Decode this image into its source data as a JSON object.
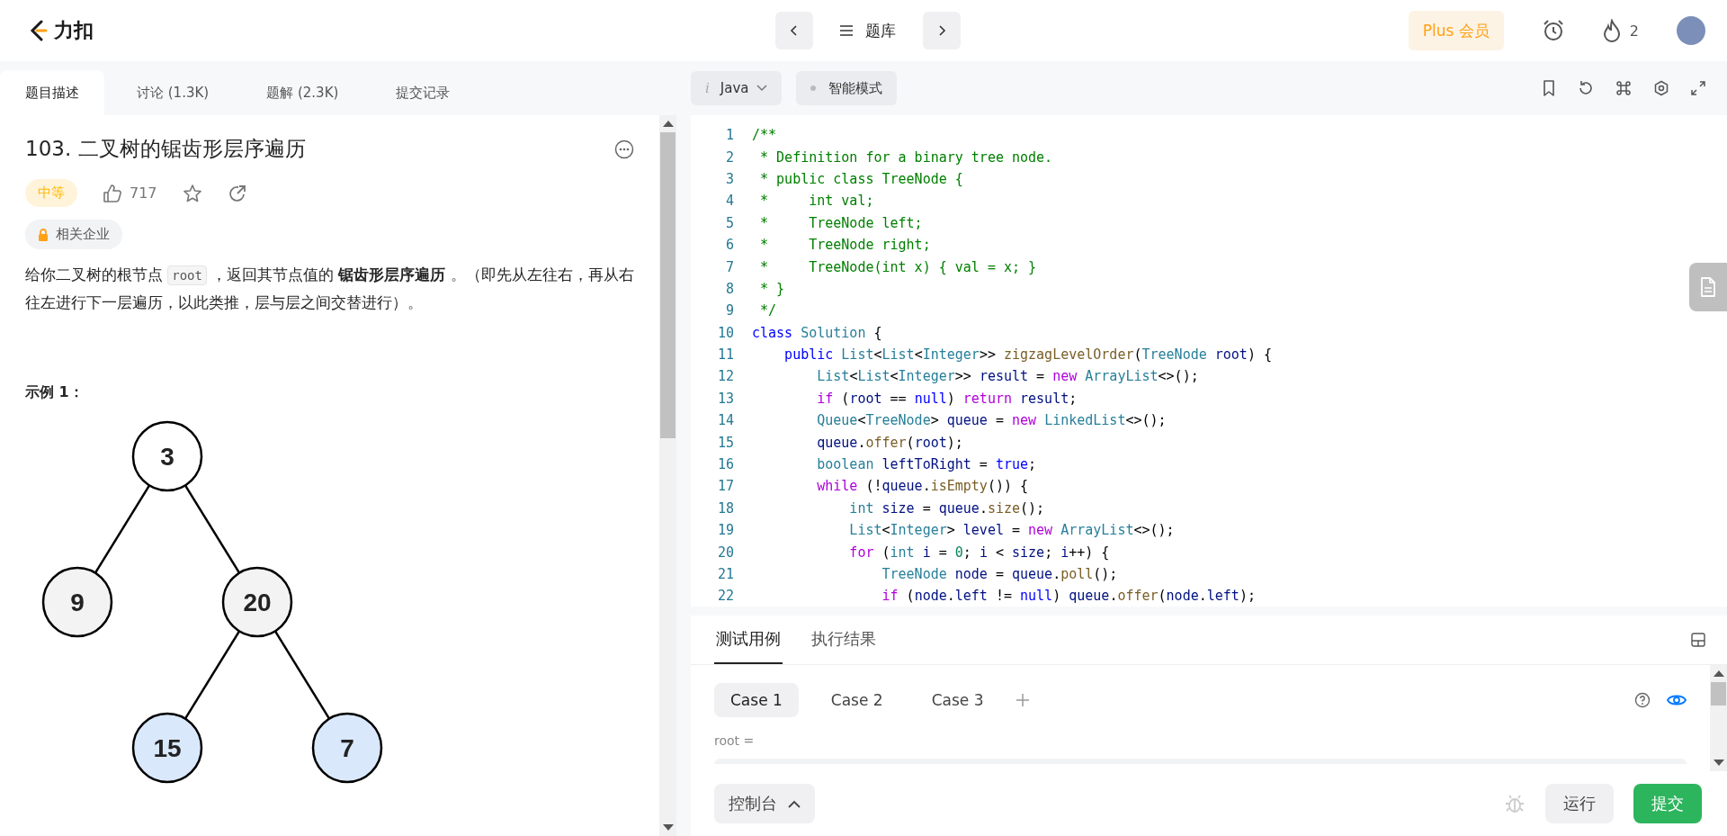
{
  "nav": {
    "logo_text": "力扣",
    "problem_list": "题库",
    "plus": "Plus 会员",
    "streak": "2"
  },
  "left_tabs": [
    {
      "label": "题目描述",
      "selected": true
    },
    {
      "label": "讨论 (1.3K)",
      "selected": false
    },
    {
      "label": "题解 (2.3K)",
      "selected": false
    },
    {
      "label": "提交记录",
      "selected": false
    }
  ],
  "problem": {
    "title": "103. 二叉树的锯齿形层序遍历",
    "difficulty": "中等",
    "likes": "717",
    "companies": "相关企业",
    "description": [
      {
        "kind": "text",
        "text": "给你二叉树的根节点 "
      },
      {
        "kind": "code",
        "text": "root"
      },
      {
        "kind": "text",
        "text": " ，返回其节点值的 **锯齿形层序遍历** 。（即先从左往右，再从右往左进行下一层遍历，以此类推，层与层之间交替进行）。"
      }
    ],
    "example_title": "示例 1：",
    "tree": {
      "value": "3",
      "color": "#ffffff",
      "children": [
        {
          "value": "9",
          "color": "#f3f3f3"
        },
        {
          "value": "20",
          "color": "#f3f3f3",
          "children": [
            {
              "value": "15",
              "color": "#dae8fc"
            },
            {
              "value": "7",
              "color": "#dae8fc"
            }
          ]
        }
      ]
    }
  },
  "editor": {
    "language_icon": "i",
    "language": "Java",
    "mode": "智能模式",
    "lines": [
      {
        "number": "1",
        "tokens": [
          {
            "kind": "comment",
            "text": "/**"
          }
        ]
      },
      {
        "number": "2",
        "tokens": [
          {
            "kind": "comment",
            "text": " * Definition for a binary tree node."
          }
        ]
      },
      {
        "number": "3",
        "tokens": [
          {
            "kind": "comment",
            "text": " * public class TreeNode {"
          }
        ]
      },
      {
        "number": "4",
        "tokens": [
          {
            "kind": "comment",
            "text": " *     int val;"
          }
        ]
      },
      {
        "number": "5",
        "tokens": [
          {
            "kind": "comment",
            "text": " *     TreeNode left;"
          }
        ]
      },
      {
        "number": "6",
        "tokens": [
          {
            "kind": "comment",
            "text": " *     TreeNode right;"
          }
        ]
      },
      {
        "number": "7",
        "tokens": [
          {
            "kind": "comment",
            "text": " *     TreeNode(int x) { val = x; }"
          }
        ]
      },
      {
        "number": "8",
        "tokens": [
          {
            "kind": "comment",
            "text": " * }"
          }
        ]
      },
      {
        "number": "9",
        "tokens": [
          {
            "kind": "comment",
            "text": " */"
          }
        ]
      },
      {
        "number": "10",
        "tokens": [
          {
            "kind": "keyword",
            "text": "class "
          },
          {
            "kind": "type",
            "text": "Solution"
          },
          {
            "kind": "plain",
            "text": " {"
          }
        ]
      },
      {
        "number": "11",
        "tokens": [
          {
            "kind": "keyword",
            "text": "    public "
          },
          {
            "kind": "type",
            "text": "List"
          },
          {
            "kind": "plain",
            "text": "<"
          },
          {
            "kind": "type",
            "text": "List"
          },
          {
            "kind": "plain",
            "text": "<"
          },
          {
            "kind": "type",
            "text": "Integer"
          },
          {
            "kind": "plain",
            "text": ">> "
          },
          {
            "kind": "function",
            "text": "zigzagLevelOrder"
          },
          {
            "kind": "plain",
            "text": "("
          },
          {
            "kind": "type",
            "text": "TreeNode "
          },
          {
            "kind": "variable",
            "text": "root"
          },
          {
            "kind": "plain",
            "text": ") {"
          }
        ]
      },
      {
        "number": "12",
        "tokens": [
          {
            "kind": "type",
            "text": "        List"
          },
          {
            "kind": "plain",
            "text": "<"
          },
          {
            "kind": "type",
            "text": "List"
          },
          {
            "kind": "plain",
            "text": "<"
          },
          {
            "kind": "type",
            "text": "Integer"
          },
          {
            "kind": "plain",
            "text": ">> "
          },
          {
            "kind": "variable",
            "text": "result"
          },
          {
            "kind": "plain",
            "text": " = "
          },
          {
            "kind": "control",
            "text": "new "
          },
          {
            "kind": "type",
            "text": "ArrayList"
          },
          {
            "kind": "plain",
            "text": "<>();"
          }
        ]
      },
      {
        "number": "13",
        "tokens": [
          {
            "kind": "control",
            "text": "        if"
          },
          {
            "kind": "plain",
            "text": " ("
          },
          {
            "kind": "variable",
            "text": "root"
          },
          {
            "kind": "plain",
            "text": " == "
          },
          {
            "kind": "keyword",
            "text": "null"
          },
          {
            "kind": "plain",
            "text": ") "
          },
          {
            "kind": "control",
            "text": "return "
          },
          {
            "kind": "variable",
            "text": "result"
          },
          {
            "kind": "plain",
            "text": ";"
          }
        ]
      },
      {
        "number": "14",
        "tokens": [
          {
            "kind": "type",
            "text": "        Queue"
          },
          {
            "kind": "plain",
            "text": "<"
          },
          {
            "kind": "type",
            "text": "TreeNode"
          },
          {
            "kind": "plain",
            "text": "> "
          },
          {
            "kind": "variable",
            "text": "queue"
          },
          {
            "kind": "plain",
            "text": " = "
          },
          {
            "kind": "control",
            "text": "new "
          },
          {
            "kind": "type",
            "text": "LinkedList"
          },
          {
            "kind": "plain",
            "text": "<>();"
          }
        ]
      },
      {
        "number": "15",
        "tokens": [
          {
            "kind": "variable",
            "text": "        queue"
          },
          {
            "kind": "plain",
            "text": "."
          },
          {
            "kind": "function",
            "text": "offer"
          },
          {
            "kind": "plain",
            "text": "("
          },
          {
            "kind": "variable",
            "text": "root"
          },
          {
            "kind": "plain",
            "text": ");"
          }
        ]
      },
      {
        "number": "16",
        "tokens": [
          {
            "kind": "type",
            "text": "        boolean "
          },
          {
            "kind": "variable",
            "text": "leftToRight"
          },
          {
            "kind": "plain",
            "text": " = "
          },
          {
            "kind": "keyword",
            "text": "true"
          },
          {
            "kind": "plain",
            "text": ";"
          }
        ]
      },
      {
        "number": "17",
        "tokens": [
          {
            "kind": "control",
            "text": "        while"
          },
          {
            "kind": "plain",
            "text": " (!"
          },
          {
            "kind": "variable",
            "text": "queue"
          },
          {
            "kind": "plain",
            "text": "."
          },
          {
            "kind": "function",
            "text": "isEmpty"
          },
          {
            "kind": "plain",
            "text": "()) {"
          }
        ]
      },
      {
        "number": "18",
        "tokens": [
          {
            "kind": "type",
            "text": "            int "
          },
          {
            "kind": "variable",
            "text": "size"
          },
          {
            "kind": "plain",
            "text": " = "
          },
          {
            "kind": "variable",
            "text": "queue"
          },
          {
            "kind": "plain",
            "text": "."
          },
          {
            "kind": "function",
            "text": "size"
          },
          {
            "kind": "plain",
            "text": "();"
          }
        ]
      },
      {
        "number": "19",
        "tokens": [
          {
            "kind": "type",
            "text": "            List"
          },
          {
            "kind": "plain",
            "text": "<"
          },
          {
            "kind": "type",
            "text": "Integer"
          },
          {
            "kind": "plain",
            "text": "> "
          },
          {
            "kind": "variable",
            "text": "level"
          },
          {
            "kind": "plain",
            "text": " = "
          },
          {
            "kind": "control",
            "text": "new "
          },
          {
            "kind": "type",
            "text": "ArrayList"
          },
          {
            "kind": "plain",
            "text": "<>();"
          }
        ]
      },
      {
        "number": "20",
        "tokens": [
          {
            "kind": "control",
            "text": "            for"
          },
          {
            "kind": "plain",
            "text": " ("
          },
          {
            "kind": "type",
            "text": "int "
          },
          {
            "kind": "variable",
            "text": "i"
          },
          {
            "kind": "plain",
            "text": " = "
          },
          {
            "kind": "number",
            "text": "0"
          },
          {
            "kind": "plain",
            "text": "; "
          },
          {
            "kind": "variable",
            "text": "i"
          },
          {
            "kind": "plain",
            "text": " < "
          },
          {
            "kind": "variable",
            "text": "size"
          },
          {
            "kind": "plain",
            "text": "; "
          },
          {
            "kind": "variable",
            "text": "i"
          },
          {
            "kind": "plain",
            "text": "++) {"
          }
        ]
      },
      {
        "number": "21",
        "tokens": [
          {
            "kind": "type",
            "text": "                TreeNode "
          },
          {
            "kind": "variable",
            "text": "node"
          },
          {
            "kind": "plain",
            "text": " = "
          },
          {
            "kind": "variable",
            "text": "queue"
          },
          {
            "kind": "plain",
            "text": "."
          },
          {
            "kind": "function",
            "text": "poll"
          },
          {
            "kind": "plain",
            "text": "();"
          }
        ]
      },
      {
        "number": "22",
        "tokens": [
          {
            "kind": "control",
            "text": "                if"
          },
          {
            "kind": "plain",
            "text": " ("
          },
          {
            "kind": "variable",
            "text": "node"
          },
          {
            "kind": "plain",
            "text": "."
          },
          {
            "kind": "variable",
            "text": "left"
          },
          {
            "kind": "plain",
            "text": " != "
          },
          {
            "kind": "keyword",
            "text": "null"
          },
          {
            "kind": "plain",
            "text": ") "
          },
          {
            "kind": "variable",
            "text": "queue"
          },
          {
            "kind": "plain",
            "text": "."
          },
          {
            "kind": "function",
            "text": "offer"
          },
          {
            "kind": "plain",
            "text": "("
          },
          {
            "kind": "variable",
            "text": "node"
          },
          {
            "kind": "plain",
            "text": "."
          },
          {
            "kind": "variable",
            "text": "left"
          },
          {
            "kind": "plain",
            "text": ");"
          }
        ]
      }
    ]
  },
  "bottom": {
    "tabs": [
      {
        "label": "测试用例",
        "selected": true
      },
      {
        "label": "执行结果",
        "selected": false
      }
    ],
    "cases": [
      {
        "label": "Case 1",
        "selected": true
      },
      {
        "label": "Case 2",
        "selected": false
      },
      {
        "label": "Case 3",
        "selected": false
      }
    ],
    "param_label": "root =",
    "console": "控制台",
    "run": "运行",
    "submit": "提交"
  }
}
